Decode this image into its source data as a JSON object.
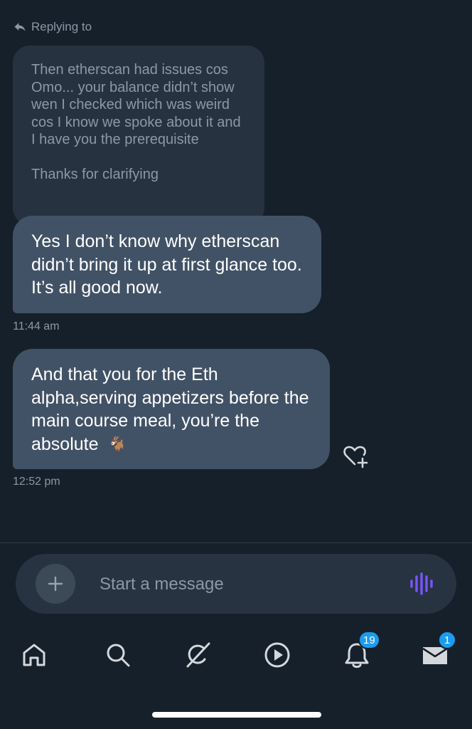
{
  "replying_to": {
    "label": "Replying to",
    "icon": "reply-arrow-icon"
  },
  "quoted_message": {
    "paragraphs": [
      "Then etherscan had issues cos Omo... your balance didn’t show wen I checked which was weird cos I know we spoke about it and I have you the prerequisite",
      "Thanks for clarifying"
    ]
  },
  "messages": [
    {
      "text": "Yes I don’t know why etherscan didn’t bring it up at first glance too. It’s all good now.",
      "time": "11:44 am"
    },
    {
      "text": "And that you for the Eth alpha,serving appetizers before the main course meal, you’re the absolute",
      "emoji": "🐐",
      "time": "12:52 pm"
    }
  ],
  "composer": {
    "placeholder": "Start a message",
    "add_icon": "plus-icon",
    "voice_icon": "voice-waveform-icon"
  },
  "nav": {
    "items": [
      {
        "icon": "home-icon"
      },
      {
        "icon": "search-icon"
      },
      {
        "icon": "grok-icon"
      },
      {
        "icon": "play-icon"
      },
      {
        "icon": "bell-icon",
        "badge": "19"
      },
      {
        "icon": "mail-icon",
        "badge": "1"
      }
    ]
  },
  "colors": {
    "accent": "#1d9bf0",
    "background": "#15202b",
    "bubble": "#425266",
    "quoted_bubble": "#263240",
    "voice": "#7856ff"
  }
}
